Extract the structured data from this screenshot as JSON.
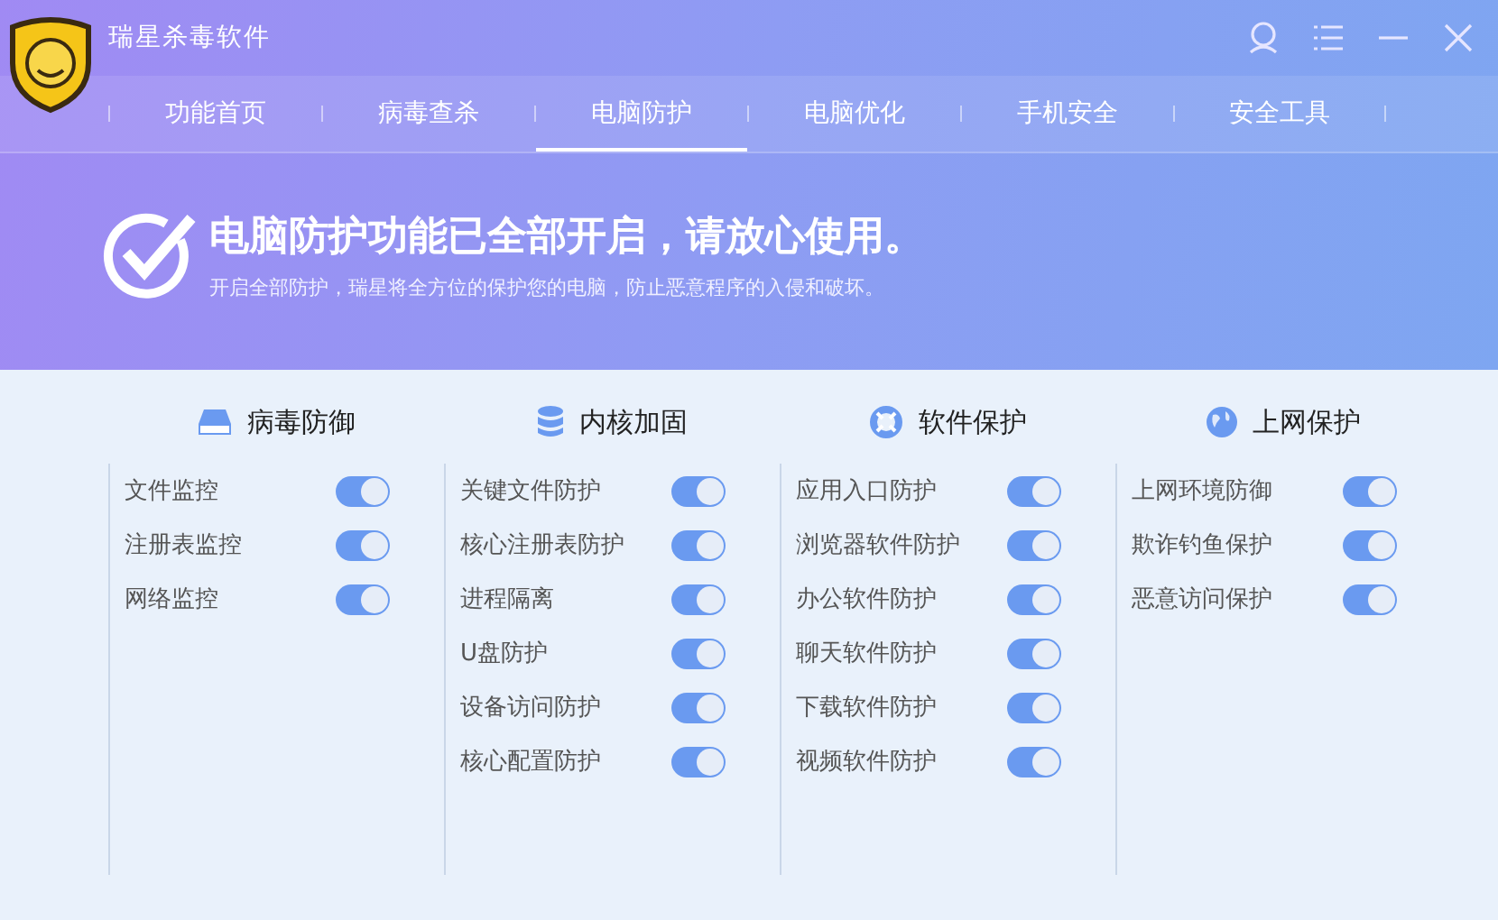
{
  "window": {
    "title": "瑞星杀毒软件"
  },
  "tabs": [
    {
      "label": "功能首页",
      "selected": false
    },
    {
      "label": "病毒查杀",
      "selected": false
    },
    {
      "label": "电脑防护",
      "selected": true
    },
    {
      "label": "电脑优化",
      "selected": false
    },
    {
      "label": "手机安全",
      "selected": false
    },
    {
      "label": "安全工具",
      "selected": false
    }
  ],
  "banner": {
    "title": "电脑防护功能已全部开启，请放心使用。",
    "subtitle": "开启全部防护，瑞星将全方位的保护您的电脑，防止恶意程序的入侵和破坏。"
  },
  "sections": [
    {
      "title": "病毒防御",
      "kind": "drive",
      "items": [
        {
          "label": "文件监控",
          "on": true
        },
        {
          "label": "注册表监控",
          "on": true
        },
        {
          "label": "网络监控",
          "on": true
        }
      ]
    },
    {
      "title": "内核加固",
      "kind": "database",
      "items": [
        {
          "label": "关键文件防护",
          "on": true
        },
        {
          "label": "核心注册表防护",
          "on": true
        },
        {
          "label": "进程隔离",
          "on": true
        },
        {
          "label": "U盘防护",
          "on": true
        },
        {
          "label": "设备访问防护",
          "on": true
        },
        {
          "label": "核心配置防护",
          "on": true
        }
      ]
    },
    {
      "title": "软件保护",
      "kind": "lifebuoy",
      "items": [
        {
          "label": "应用入口防护",
          "on": true
        },
        {
          "label": "浏览器软件防护",
          "on": true
        },
        {
          "label": "办公软件防护",
          "on": true
        },
        {
          "label": "聊天软件防护",
          "on": true
        },
        {
          "label": "下载软件防护",
          "on": true
        },
        {
          "label": "视频软件防护",
          "on": true
        }
      ]
    },
    {
      "title": "上网保护",
      "kind": "globe",
      "items": [
        {
          "label": "上网环境防御",
          "on": true
        },
        {
          "label": "欺诈钓鱼保护",
          "on": true
        },
        {
          "label": "恶意访问保护",
          "on": true
        }
      ]
    }
  ]
}
